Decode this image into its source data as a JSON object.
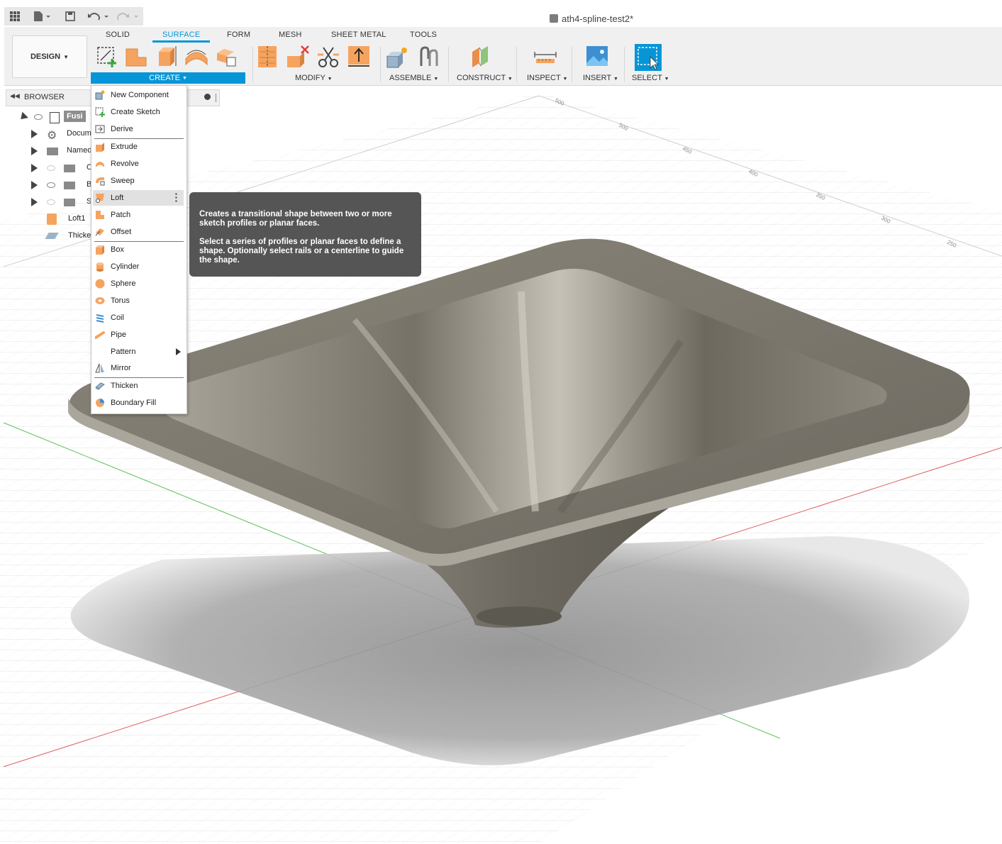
{
  "window": {
    "title": "ath4-spline-test2*"
  },
  "quick_access": {
    "icons": [
      "grid-menu-icon",
      "file-icon",
      "save-icon",
      "undo-icon",
      "redo-icon"
    ]
  },
  "workspace": {
    "label": "DESIGN"
  },
  "tabs": [
    {
      "label": "SOLID"
    },
    {
      "label": "SURFACE",
      "active": true
    },
    {
      "label": "FORM"
    },
    {
      "label": "MESH"
    },
    {
      "label": "SHEET METAL"
    },
    {
      "label": "TOOLS"
    }
  ],
  "groups": {
    "create": "CREATE",
    "modify": "MODIFY",
    "assemble": "ASSEMBLE",
    "construct": "CONSTRUCT",
    "inspect": "INSPECT",
    "insert": "INSERT",
    "select": "SELECT"
  },
  "browser": {
    "title": "BROWSER",
    "rows": [
      {
        "label": "Fusi"
      },
      {
        "label": "Docum"
      },
      {
        "label": "Named"
      },
      {
        "label": "O"
      },
      {
        "label": "B"
      },
      {
        "label": "S"
      },
      {
        "label": "Loft1"
      },
      {
        "label": "Thicke"
      }
    ]
  },
  "create_menu": {
    "items": [
      {
        "label": "New Component",
        "icon": "new-component-icon"
      },
      {
        "label": "Create Sketch",
        "icon": "create-sketch-icon"
      },
      {
        "label": "Derive",
        "icon": "derive-icon"
      },
      {
        "label": "Extrude",
        "icon": "extrude-icon"
      },
      {
        "label": "Revolve",
        "icon": "revolve-icon"
      },
      {
        "label": "Sweep",
        "icon": "sweep-icon"
      },
      {
        "label": "Loft",
        "icon": "loft-icon",
        "highlighted": true
      },
      {
        "label": "Patch",
        "icon": "patch-icon"
      },
      {
        "label": "Offset",
        "icon": "offset-icon"
      },
      {
        "label": "Box",
        "icon": "box-icon"
      },
      {
        "label": "Cylinder",
        "icon": "cylinder-icon"
      },
      {
        "label": "Sphere",
        "icon": "sphere-icon"
      },
      {
        "label": "Torus",
        "icon": "torus-icon"
      },
      {
        "label": "Coil",
        "icon": "coil-icon"
      },
      {
        "label": "Pipe",
        "icon": "pipe-icon"
      },
      {
        "label": "Pattern",
        "icon": "submenu-arrow-icon"
      },
      {
        "label": "Mirror",
        "icon": "mirror-icon"
      },
      {
        "label": "Thicken",
        "icon": "thicken-icon"
      },
      {
        "label": "Boundary Fill",
        "icon": "boundary-fill-icon"
      }
    ]
  },
  "tooltip": {
    "line1": "Creates a transitional shape between two or more sketch profiles or planar faces.",
    "line2": "Select a series of profiles or planar faces to define a shape. Optionally select rails or a centerline to guide the shape."
  },
  "grid_ticks": [
    "500",
    "500",
    "450",
    "400",
    "350",
    "300",
    "250"
  ],
  "colors": {
    "accent": "#0696d7",
    "tool_orange": "#f5a460",
    "model_gray": "#7b776f",
    "tooltip_bg": "#555555",
    "x_axis": "#e06060",
    "y_axis": "#60c060"
  }
}
